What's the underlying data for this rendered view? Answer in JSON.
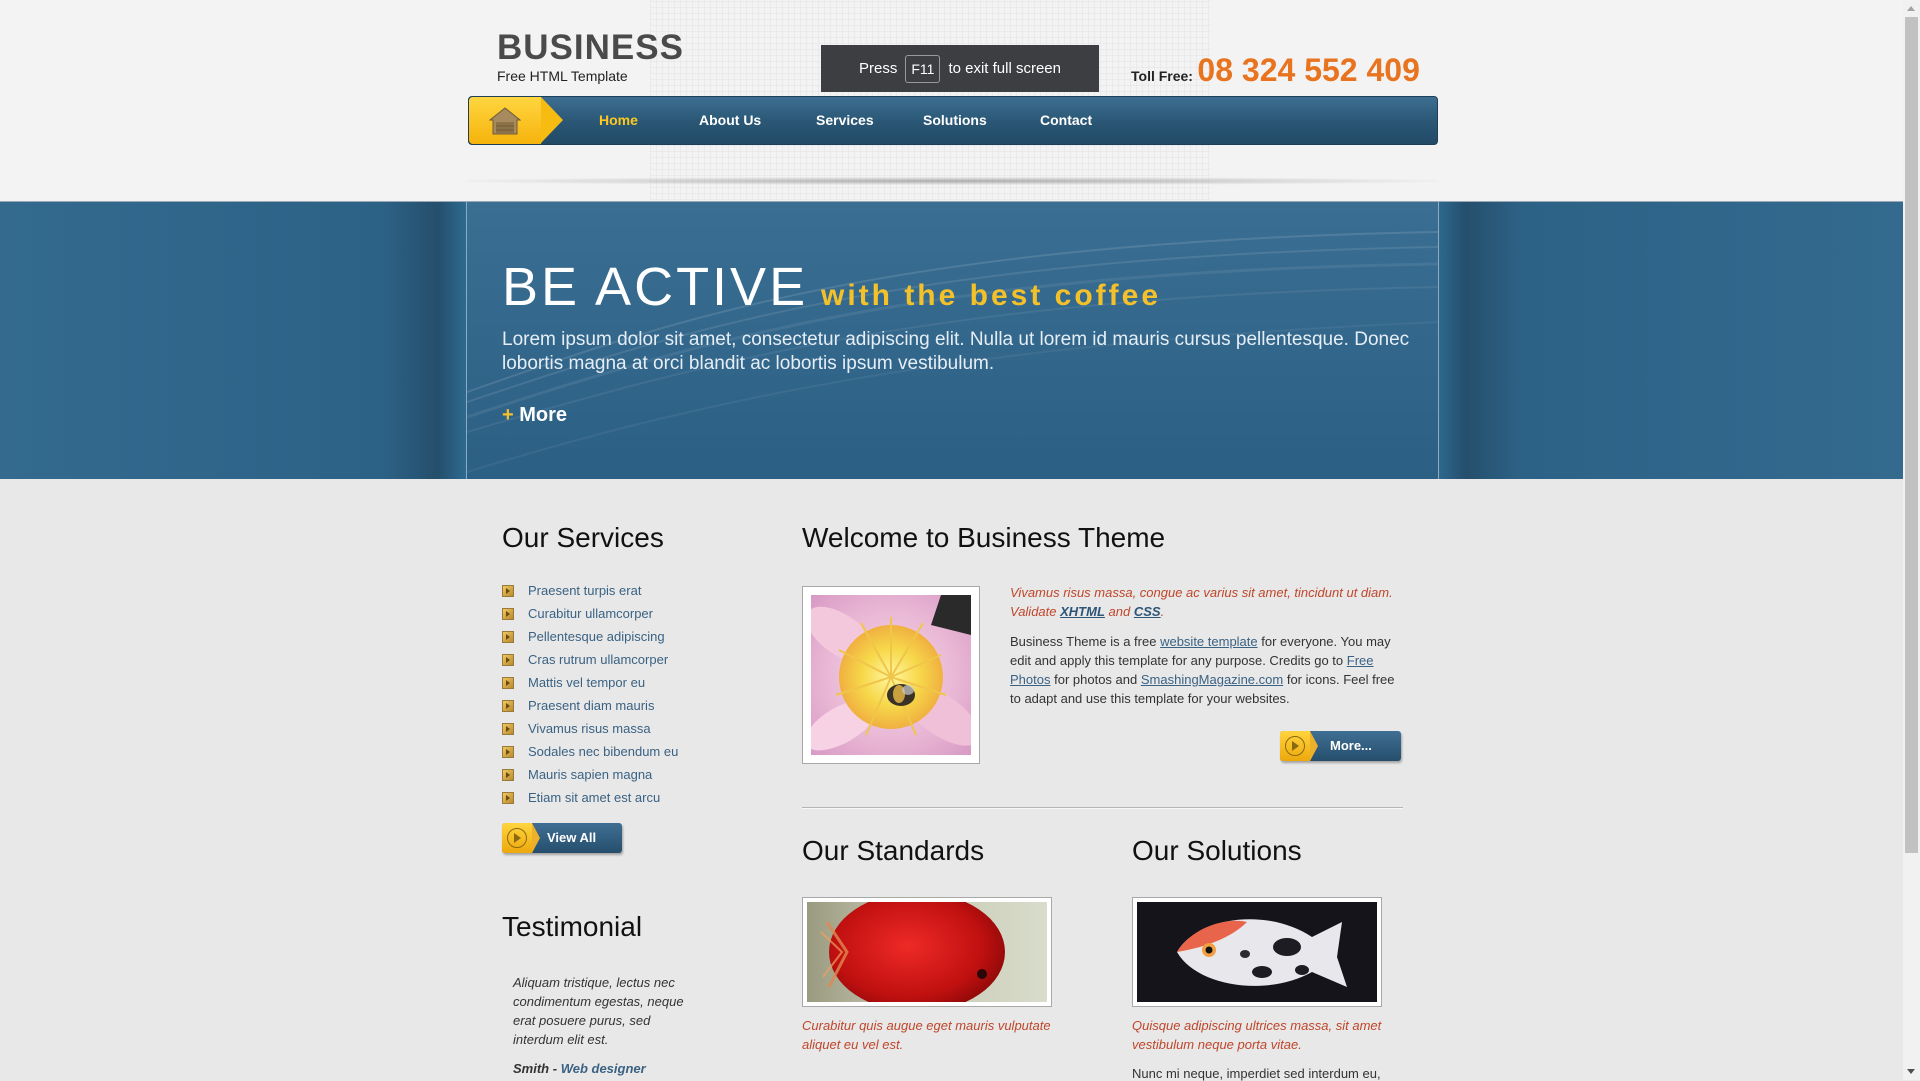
{
  "header": {
    "logo_title": "BUSINESS",
    "logo_subtitle": "Free HTML Template",
    "fullscreen_notice": {
      "before": "Press",
      "key": "F11",
      "after": "to exit full screen"
    },
    "toll_free_label": "Toll Free:",
    "toll_free_number": "08 324 552 409"
  },
  "nav": {
    "home_icon": "house-icon",
    "items": [
      {
        "label": "Home",
        "active": true
      },
      {
        "label": "About Us"
      },
      {
        "label": "Services"
      },
      {
        "label": "Solutions"
      },
      {
        "label": "Contact"
      }
    ]
  },
  "banner": {
    "title": "BE ACTIVE",
    "tagline": "with the best coffee",
    "text": "Lorem ipsum dolor sit amet, consectetur adipiscing elit. Nulla ut lorem id mauris cursus pellentesque. Donec lobortis magna at orci blandit ac lobortis ipsum vestibulum.",
    "more_plus": "+",
    "more_label": "More"
  },
  "services": {
    "heading": "Our Services",
    "items": [
      "Praesent turpis erat",
      "Curabitur ullamcorper",
      "Pellentesque adipiscing",
      "Cras rutrum ullamcorper",
      "Mattis vel tempor eu",
      "Praesent diam mauris",
      "Vivamus risus massa",
      "Sodales nec bibendum eu",
      "Mauris sapien magna",
      "Etiam sit amet est arcu"
    ],
    "view_all_label": "View All"
  },
  "testimonial": {
    "heading": "Testimonial",
    "text": "Aliquam tristique, lectus nec condimentum egestas, neque erat posuere purus, sed interdum elit est.",
    "author": "Smith",
    "separator": " - ",
    "role": "Web designer"
  },
  "welcome": {
    "heading": "Welcome to Business Theme",
    "image": "flower-bee-photo",
    "italic_text": "Vivamus risus massa, congue ac varius sit amet, tincidunt ut diam. Validate",
    "xhtml_link": "XHTML",
    "and_text": "and",
    "css_link": "CSS",
    "period": ".",
    "body_1": "Business Theme is a free",
    "website_template_link": "website template",
    "body_2": "for everyone. You may edit and apply this template for any purpose. Credits go to",
    "free_photos_link": "Free Photos",
    "body_3": "for photos and",
    "smashing_link": "SmashingMagazine.com",
    "body_4": "for icons. Feel free to adapt and use this template for your websites.",
    "more_label": "More..."
  },
  "standards": {
    "heading": "Our Standards",
    "image": "red-fish-photo",
    "caption": "Curabitur quis augue eget mauris vulputate aliquet eu vel est."
  },
  "solutions": {
    "heading": "Our Solutions",
    "image": "angelfish-photo",
    "caption": "Quisque adipiscing ultrices massa, sit amet vestibulum neque porta vitae.",
    "body": "Nunc mi neque, imperdiet sed interdum eu,"
  },
  "colors": {
    "accent_orange": "#e8741f",
    "nav_blue": "#2b5876",
    "banner_blue": "#2e6a90",
    "highlight_yellow": "#f4c12a",
    "link_blue": "#3a6283",
    "italic_red": "#c0462a"
  }
}
